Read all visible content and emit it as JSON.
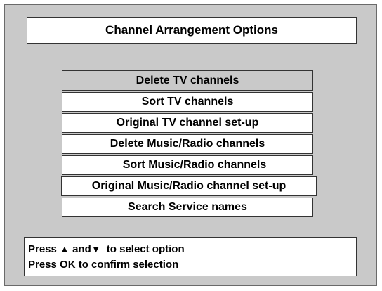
{
  "header": {
    "title": "Channel Arrangement Options"
  },
  "menu": {
    "items": [
      {
        "label": "Delete TV channels",
        "selected": true
      },
      {
        "label": "Sort TV channels",
        "selected": false
      },
      {
        "label": "Original TV channel set-up",
        "selected": false
      },
      {
        "label": "Delete Music/Radio channels",
        "selected": false
      },
      {
        "label": "Sort Music/Radio channels",
        "selected": false
      },
      {
        "label": "Original Music/Radio channel set-up",
        "selected": false
      },
      {
        "label": "Search Service names",
        "selected": false
      }
    ]
  },
  "help": {
    "line1_prefix": "Press",
    "up_arrow": "▲",
    "line1_and": "and",
    "down_arrow": "▼",
    "line1_suffix": "to select option",
    "line2": "Press OK to confirm selection"
  },
  "colors": {
    "background": "#c9c9c9",
    "panel": "#ffffff",
    "selected": "#c9c9c9"
  }
}
